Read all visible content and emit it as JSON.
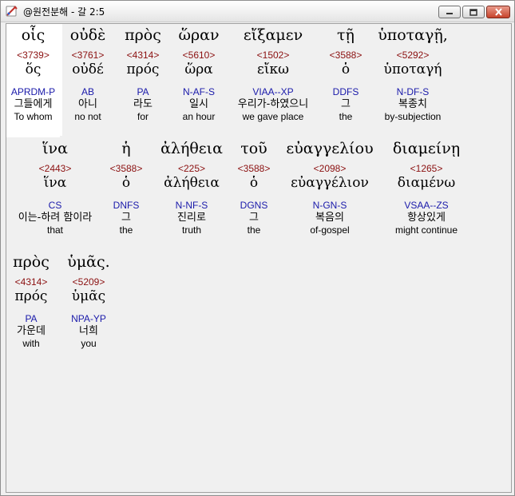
{
  "window": {
    "title": "@원전분해 - 갈 2:5",
    "minimize_icon": "minimize-icon",
    "maximize_icon": "maximize-icon",
    "close_icon": "close-icon"
  },
  "words": [
    {
      "greek": "οἷς",
      "strong": "<3739>",
      "lemma": "ὅς",
      "parse": "APRDM-P",
      "korean": "그들에게",
      "english": "To whom"
    },
    {
      "greek": "οὐδὲ",
      "strong": "<3761>",
      "lemma": "οὐδέ",
      "parse": "AB",
      "korean": "아니",
      "english": "no not"
    },
    {
      "greek": "πρὸς",
      "strong": "<4314>",
      "lemma": "πρός",
      "parse": "PA",
      "korean": "라도",
      "english": "for"
    },
    {
      "greek": "ὥραν",
      "strong": "<5610>",
      "lemma": "ὥρα",
      "parse": "N-AF-S",
      "korean": "일시",
      "english": "an hour"
    },
    {
      "greek": "εἴξαμεν",
      "strong": "<1502>",
      "lemma": "εἴκω",
      "parse": "VIAA--XP",
      "korean": "우리가-하였으니",
      "english": "we gave place"
    },
    {
      "greek": "τῇ",
      "strong": "<3588>",
      "lemma": "ὁ",
      "parse": "DDFS",
      "korean": "그",
      "english": "the"
    },
    {
      "greek": "ὑποταγῇ,",
      "strong": "<5292>",
      "lemma": "ὑποταγή",
      "parse": "N-DF-S",
      "korean": "복종치",
      "english": "by-subjection"
    },
    {
      "greek": "ἵνα",
      "strong": "<2443>",
      "lemma": "ἵνα",
      "parse": "CS",
      "korean": "이는-하려 함이라",
      "english": "that"
    },
    {
      "greek": "ἡ",
      "strong": "<3588>",
      "lemma": "ὁ",
      "parse": "DNFS",
      "korean": "그",
      "english": "the"
    },
    {
      "greek": "ἀλήθεια",
      "strong": "<225>",
      "lemma": "ἀλήθεια",
      "parse": "N-NF-S",
      "korean": "진리로",
      "english": "truth"
    },
    {
      "greek": "τοῦ",
      "strong": "<3588>",
      "lemma": "ὁ",
      "parse": "DGNS",
      "korean": "그",
      "english": "the"
    },
    {
      "greek": "εὐαγγελίου",
      "strong": "<2098>",
      "lemma": "εὐαγγέλιον",
      "parse": "N-GN-S",
      "korean": "복음의",
      "english": "of-gospel"
    },
    {
      "greek": "διαμείνῃ",
      "strong": "<1265>",
      "lemma": "διαμένω",
      "parse": "VSAA--ZS",
      "korean": "항상있게",
      "english": "might continue"
    },
    {
      "greek": "πρὸς",
      "strong": "<4314>",
      "lemma": "πρός",
      "parse": "PA",
      "korean": "가운데",
      "english": "with"
    },
    {
      "greek": "ὑμᾶς.",
      "strong": "<5209>",
      "lemma": "ὑμᾶς",
      "parse": "NPA-YP",
      "korean": "너희",
      "english": "you"
    }
  ]
}
